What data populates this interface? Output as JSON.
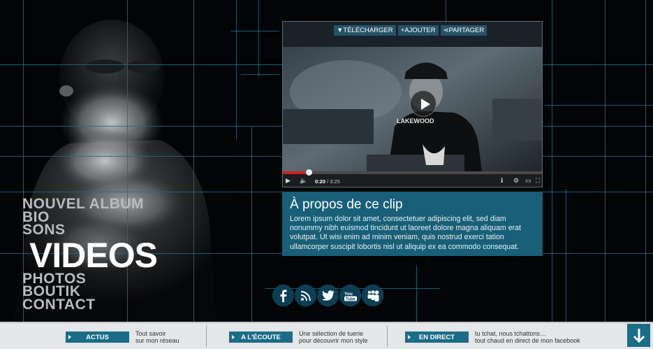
{
  "nav": {
    "items": [
      {
        "label": "NOUVEL ALBUM",
        "active": false
      },
      {
        "label": "BIO",
        "active": false
      },
      {
        "label": "SONS",
        "active": false
      },
      {
        "label": "VIDEOS",
        "active": true
      },
      {
        "label": "PHOTOS",
        "active": false
      },
      {
        "label": "BOUTIK",
        "active": false
      },
      {
        "label": "CONTACT",
        "active": false
      }
    ]
  },
  "player": {
    "download_label": "TÉLÉCHARGER",
    "add_label": "AJOUTER",
    "share_label": "PARTAGER",
    "current_time": "0:20",
    "duration": "3:25",
    "progress_fraction": 0.098,
    "shirt_text": "LAKEWOOD"
  },
  "about": {
    "title": "À propos de ce clip",
    "body": "Lorem ipsum dolor sit amet, consectetuer adipiscing elit, sed diam nonummy nibh euismod tincidunt ut laoreet dolore magna aliquam erat volutpat. Ut wisi enim ad minim veniam, quis nostrud exerci tation ullamcorper suscipit lobortis nisl ut aliquip ex ea commodo consequat."
  },
  "social": [
    "facebook-icon",
    "rss-icon",
    "twitter-icon",
    "youtube-icon",
    "myspace-icon"
  ],
  "footer": {
    "sections": [
      {
        "button": "ACTUS",
        "line1": "Tout savoir",
        "line2": "sur mon réseau"
      },
      {
        "button": "A L'ÉCOUTE",
        "line1": "Une sélection de tuerie",
        "line2": "pour découvrir mon style"
      },
      {
        "button": "EN DIRECT",
        "line1": "tu tchat, nous tchattons…",
        "line2": "tout chaud en direct de mon facebook"
      }
    ]
  },
  "colors": {
    "accent": "#1a6d88",
    "grid": "#1a6f86",
    "progress": "#d0211d"
  }
}
